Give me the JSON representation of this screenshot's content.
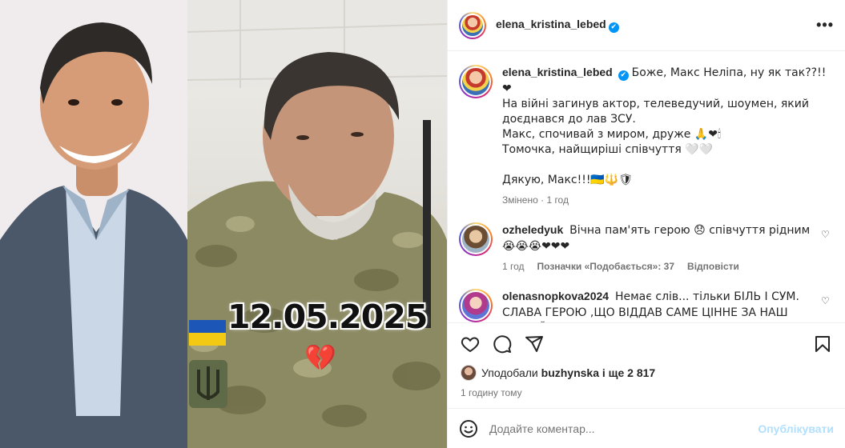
{
  "post_image": {
    "date_overlay": "12.05.2025",
    "heart_overlay": "💔"
  },
  "header": {
    "username": "elena_kristina_lebed",
    "verified_mark": "✔",
    "more_icon": "•••"
  },
  "caption": {
    "username": "elena_kristina_lebed",
    "verified_mark": "✔",
    "lines": [
      "Боже, Макс Неліпа, ну як так??!!❤",
      "На війні загинув актор, телеведучий, шоумен, який доєднався до лав ЗСУ.",
      "Макс, спочивай з миром, друже 🙏❤🕯",
      "Томочка, найщиріші співчуття 🤍🤍",
      "",
      "Дякую, Макс!!!🇺🇦🔱🛡"
    ],
    "edited_label": "Змінено",
    "time": "1 год"
  },
  "comments": [
    {
      "username": "ozheledyuk",
      "text": "Вічна пам'ять герою 😞 співчуття рідним 😭😭😭❤❤❤",
      "time": "1 год",
      "likes": "Позначки «Подобається»: 37",
      "reply": "Відповісти",
      "like_icon": "♡"
    },
    {
      "username": "olenasnopkova2024",
      "text": "Немає слів... тільки БІЛЬ І СУМ. СЛАВА ГЕРОЮ ,ЩО ВІДДАВ САМЕ ЦІННЕ ЗА НАШ СПОКІЙ...СВОЄ ЖИТТЯ 🙏🇺🇦❤🇺🇦🙏",
      "like_icon": "♡"
    }
  ],
  "actions": {
    "liked_by_prefix": "Уподобали",
    "liked_by_user": "buzhynska",
    "liked_by_suffix": "і ще 2 817",
    "time_ago": "1 годину тому"
  },
  "comment_box": {
    "emoji_icon": "☺",
    "placeholder": "Додайте коментар...",
    "post_label": "Опублікувати"
  },
  "colors": {
    "accent": "#0095f6",
    "post_disabled": "#b2dffc",
    "muted": "#737373",
    "text": "#262626"
  }
}
